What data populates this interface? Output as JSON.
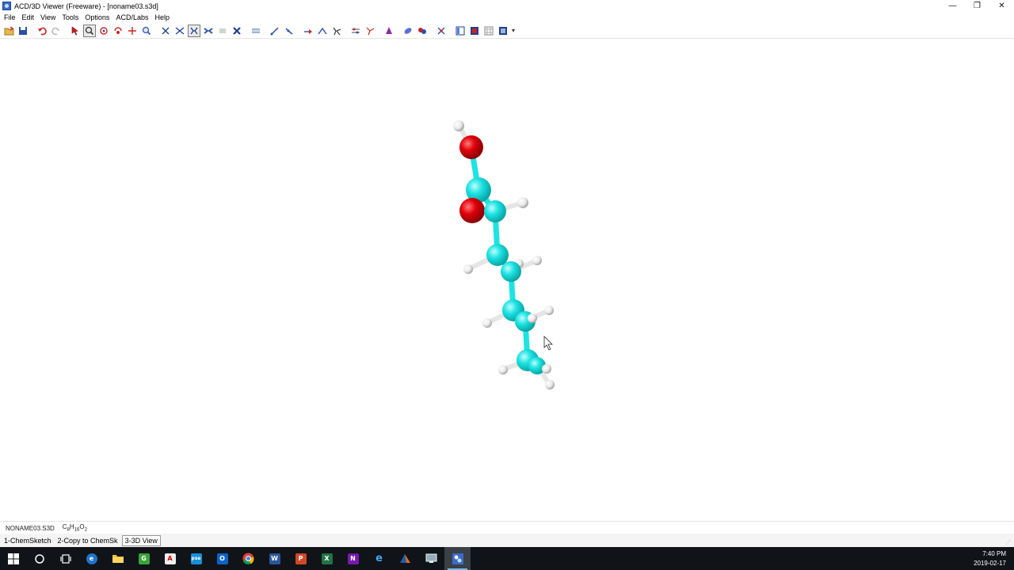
{
  "window": {
    "title": "ACD/3D Viewer (Freeware) - [noname03.s3d]",
    "controls": {
      "minimize": "—",
      "restore": "❐",
      "close": "✕"
    }
  },
  "menu": [
    "File",
    "Edit",
    "View",
    "Tools",
    "Options",
    "ACD/Labs",
    "Help"
  ],
  "toolbar": {
    "buttons": [
      "open-icon",
      "save-icon",
      "undo-icon",
      "redo-icon",
      "select-icon",
      "zoom-select-icon",
      "rotate-icon",
      "rotate-z-icon",
      "move-icon",
      "zoom-icon",
      "bond-x-icon",
      "bond-cross-icon",
      "wireframe-icon",
      "sticks-icon",
      "dots-icon",
      "ball-stick-icon",
      "spacefill-icon",
      "measure-distance-icon",
      "measure-angle-icon",
      "bond-icon",
      "angle-icon",
      "dihedral-icon",
      "optimize-icon",
      "hydrogens-icon",
      "color-icon",
      "surface-icon",
      "labels-icon",
      "tools-icon",
      "layout-icon",
      "panel-icon",
      "grid-icon",
      "settings-icon"
    ],
    "more": "▾"
  },
  "status": {
    "file": "NONAME03.S3D",
    "formula_parts": [
      "C",
      "8",
      "H",
      "16",
      "O",
      "2"
    ]
  },
  "tabs": [
    "1-ChemSketch",
    "2-Copy to ChemSk",
    "3-3D View"
  ],
  "taskbar": {
    "apps": [
      "start",
      "search",
      "task-view",
      "edge",
      "file-explorer",
      "greenshot",
      "acrobat",
      "pse",
      "outlook",
      "chrome",
      "word",
      "powerpoint",
      "excel",
      "onenote",
      "internet-explorer",
      "matlab",
      "remote-desktop",
      "acd-3d-viewer"
    ],
    "time": "7:40 PM",
    "date": "2019-02-17"
  },
  "colors": {
    "carbon": "#1ee3e3",
    "oxygen": "#e0000a",
    "hydrogen": "#f2f2f2",
    "taskbar": "#101318"
  }
}
